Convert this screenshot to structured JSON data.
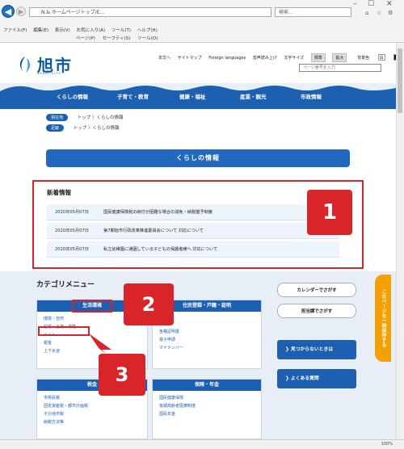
{
  "browser": {
    "address": "N.& ホームページトップ/E...",
    "search_placeholder": "検索...",
    "menu": [
      "ファイル(F)",
      "編集(E)",
      "表示(V)",
      "お気に入り(A)",
      "ツール(T)",
      "ヘルプ(H)"
    ],
    "toolbar": [
      "ページ(P)",
      "セーフティ(S)",
      "ツール(O)"
    ],
    "zoom": "100%"
  },
  "site": {
    "logo_text": "旭市",
    "logo_sub": "ASAHI CITY",
    "top_links": [
      "本文へ",
      "サイトマップ",
      "Foreign languages",
      "音声読み上げ",
      "文字サイズ"
    ],
    "size_std": "標準",
    "size_big": "拡大",
    "bg_label": "背景色",
    "bg_white": "白",
    "bg_black": "黒",
    "bg_blue": "青",
    "page_no_placeholder": "ページ番号を入力"
  },
  "nav": [
    "くらしの情報",
    "子育て・教育",
    "健康・福祉",
    "産業・観光",
    "市政情報"
  ],
  "breadcrumb": {
    "current_label": "現在地",
    "current_path": "トップ 〉くらしの情報",
    "recent_label": "足跡",
    "recent_path": "トップ 〉くらしの情報"
  },
  "banner": "くらしの情報",
  "news": {
    "title": "新着情報",
    "items": [
      {
        "date": "2020年05月07日",
        "text": "国民健康保険税の納付が困難な場合の減免・納税猶予制度"
      },
      {
        "date": "2020年05月07日",
        "text": "第7期旭市行政改革推進委員会について 対応について"
      },
      {
        "date": "2020年05月07日",
        "text": "私立幼稚園に通園している子どもの保護者様へ 対応について"
      }
    ]
  },
  "categories": {
    "title": "カテゴリメニュー",
    "cards": [
      {
        "header": "生活環境",
        "items": [
          "環境・自然",
          "住宅・土地・道路",
          "ペット",
          "税金",
          "上下水道"
        ]
      },
      {
        "header": "住民登録・戸籍・証明",
        "items": [
          "各種証明書",
          "電子申請",
          "マイナンバー"
        ]
      },
      {
        "header": "税金",
        "items": [
          "市県民税",
          "固定資産税・都市計画税",
          "その他市税",
          "納税方法等"
        ]
      },
      {
        "header": "保険・年金",
        "items": [
          "国民健康保険",
          "後期高齢者医療制度",
          "国民年金"
        ]
      }
    ]
  },
  "side": {
    "calendar": "カレンダーでさがす",
    "section": "担当課でさがす",
    "not_found": "見つからないときは",
    "faq": "よくある質問"
  },
  "sticky": "このページを一時保存する",
  "annotations": [
    "1",
    "2",
    "3"
  ],
  "colors": {
    "brand": "#1d5fb0",
    "highlight": "#d9252a",
    "sticky": "#f3a000"
  }
}
